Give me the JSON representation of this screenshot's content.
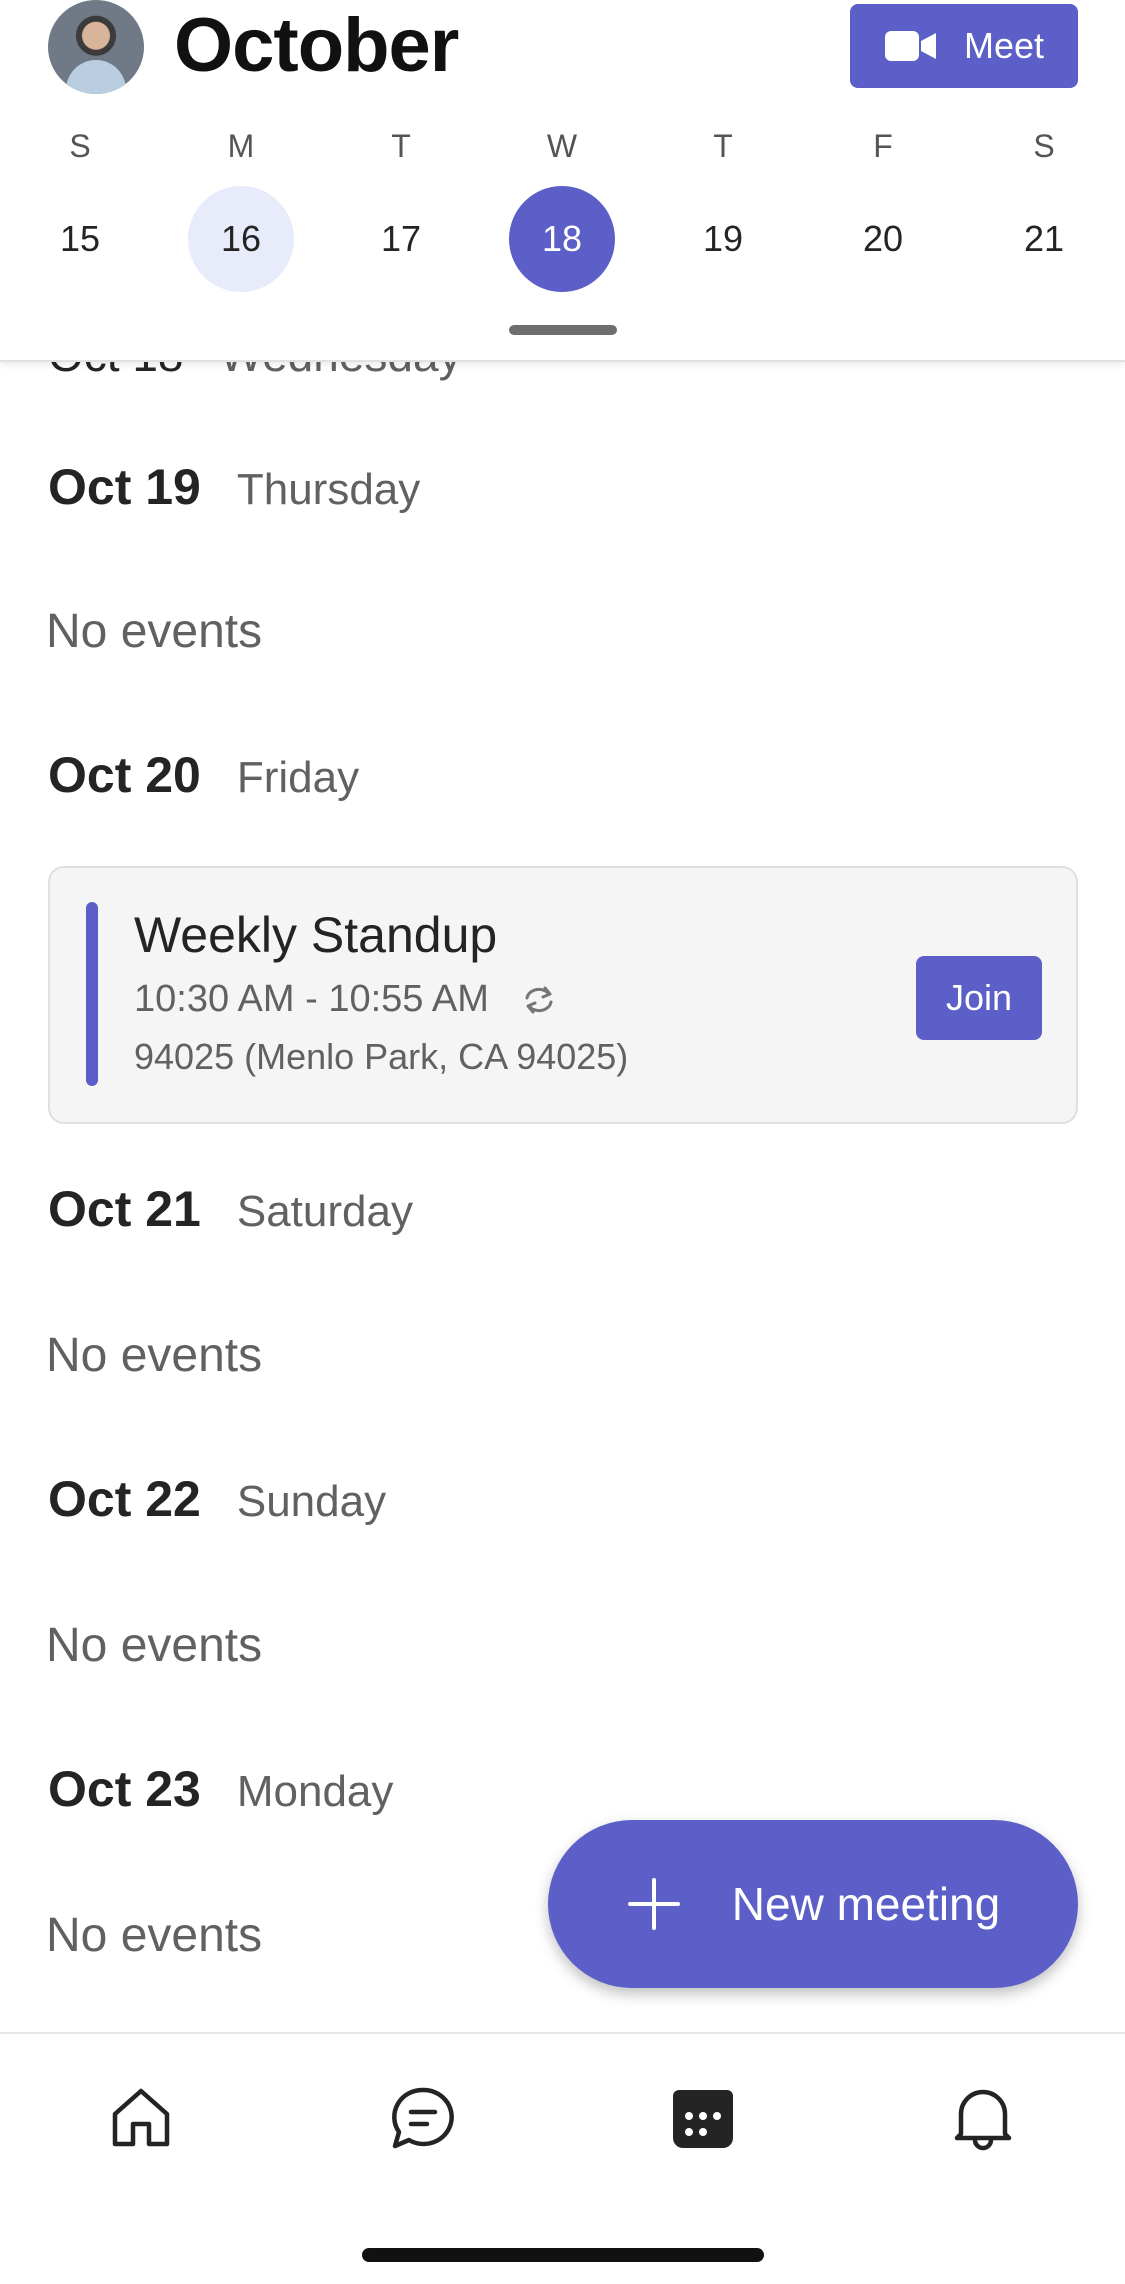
{
  "header": {
    "month": "October",
    "meet_label": "Meet",
    "weekdays": [
      "S",
      "M",
      "T",
      "W",
      "T",
      "F",
      "S"
    ],
    "days": [
      "15",
      "16",
      "17",
      "18",
      "19",
      "20",
      "21"
    ]
  },
  "agenda": {
    "cut_date": "Oct 18",
    "cut_weekday": "Wednesday",
    "sections": [
      {
        "date": "Oct 19",
        "weekday": "Thursday",
        "empty": "No events"
      },
      {
        "date": "Oct 20",
        "weekday": "Friday"
      },
      {
        "date": "Oct 21",
        "weekday": "Saturday",
        "empty": "No events"
      },
      {
        "date": "Oct 22",
        "weekday": "Sunday",
        "empty": "No events"
      },
      {
        "date": "Oct 23",
        "weekday": "Monday",
        "empty": "No events"
      }
    ],
    "event": {
      "title": "Weekly Standup",
      "time": "10:30 AM - 10:55 AM",
      "location": "94025 (Menlo Park, CA 94025)",
      "join_label": "Join",
      "recurring_icon": "recurring-icon"
    }
  },
  "fab": {
    "label": "New meeting",
    "icon": "plus-icon"
  },
  "nav": {
    "items": [
      {
        "icon": "home-icon"
      },
      {
        "icon": "chat-icon"
      },
      {
        "icon": "calendar-icon"
      },
      {
        "icon": "bell-icon"
      }
    ]
  },
  "colors": {
    "accent": "#5b5fc7",
    "accent_light": "#e8ebfa",
    "text_secondary": "#616161"
  }
}
